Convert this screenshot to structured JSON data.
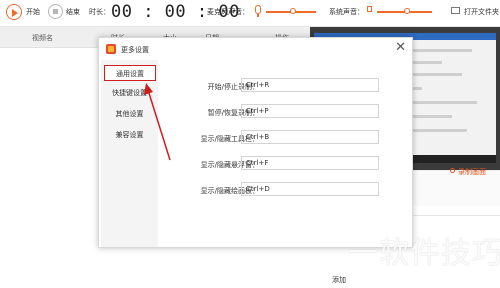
{
  "toolbar": {
    "start_label": "开始",
    "stop_label": "结束",
    "duration_label": "时长：",
    "timer": "00 : 00 : 00",
    "mic_label": "麦克风声音：",
    "system_sound_label": "系统声音：",
    "open_folder_label": "打开文件夹"
  },
  "columns": [
    "视频名",
    "时长",
    "大小",
    "日期",
    "操作"
  ],
  "dialog": {
    "title": "更多设置",
    "close_glyph": "✕",
    "sidebar": [
      {
        "label": "通用设置",
        "active": true
      },
      {
        "label": "快捷键设置",
        "active": false
      },
      {
        "label": "其他设置",
        "active": false
      },
      {
        "label": "兼容设置",
        "active": false
      }
    ],
    "shortcuts": [
      {
        "label": "开始/停止录制：",
        "value": "Ctrl+R"
      },
      {
        "label": "暂停/恢复录制：",
        "value": "Ctrl+P"
      },
      {
        "label": "显示/隐藏工具栏：",
        "value": "Ctrl+B"
      },
      {
        "label": "显示/隐藏悬浮窗：",
        "value": "Ctrl+F"
      },
      {
        "label": "显示/隐藏绘画板：",
        "value": "Ctrl+D"
      }
    ]
  },
  "right_panel": {
    "record_window_label": "录制画面",
    "add_label": "添加"
  },
  "watermark": "一软件技巧",
  "colors": {
    "accent": "#f06a2a",
    "highlight_red": "#cf1d1d"
  }
}
